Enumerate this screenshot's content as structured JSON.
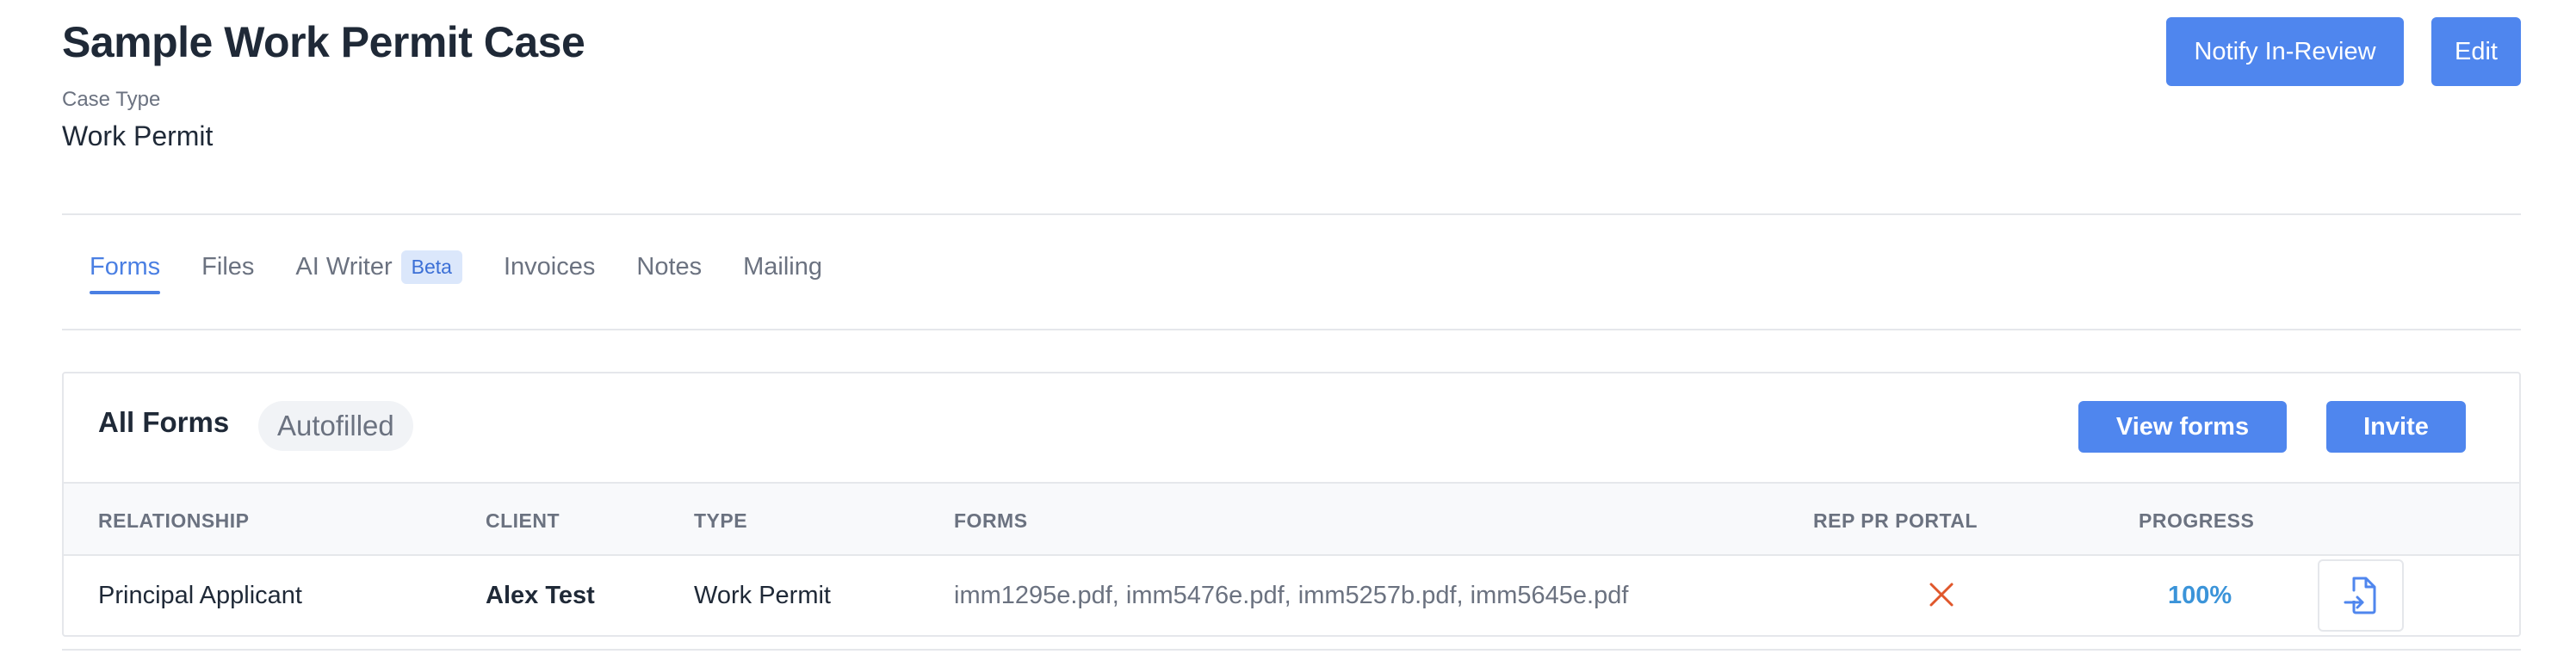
{
  "header": {
    "title": "Sample Work Permit Case",
    "case_type_label": "Case Type",
    "case_type_value": "Work Permit",
    "notify_label": "Notify In-Review",
    "edit_label": "Edit"
  },
  "tabs": [
    {
      "label": "Forms",
      "active": true
    },
    {
      "label": "Files"
    },
    {
      "label": "AI Writer",
      "badge": "Beta"
    },
    {
      "label": "Invoices"
    },
    {
      "label": "Notes"
    },
    {
      "label": "Mailing"
    }
  ],
  "forms_card": {
    "title": "All Forms",
    "filter_pill": "Autofilled",
    "view_forms_label": "View forms",
    "invite_label": "Invite",
    "columns": [
      "RELATIONSHIP",
      "CLIENT",
      "TYPE",
      "FORMS",
      "REP PR PORTAL",
      "PROGRESS"
    ],
    "rows": [
      {
        "relationship": "Principal Applicant",
        "client": "Alex Test",
        "type": "Work Permit",
        "forms": "imm1295e.pdf, imm5476e.pdf, imm5257b.pdf, imm5645e.pdf",
        "rep_pr_portal_icon": "x-icon",
        "progress": "100%",
        "action_icon": "file-import-icon"
      }
    ]
  },
  "colors": {
    "primary": "#4f86ee",
    "active_tab": "#4a7fe3",
    "progress": "#3b94d9",
    "x_icon": "#e0572b"
  }
}
